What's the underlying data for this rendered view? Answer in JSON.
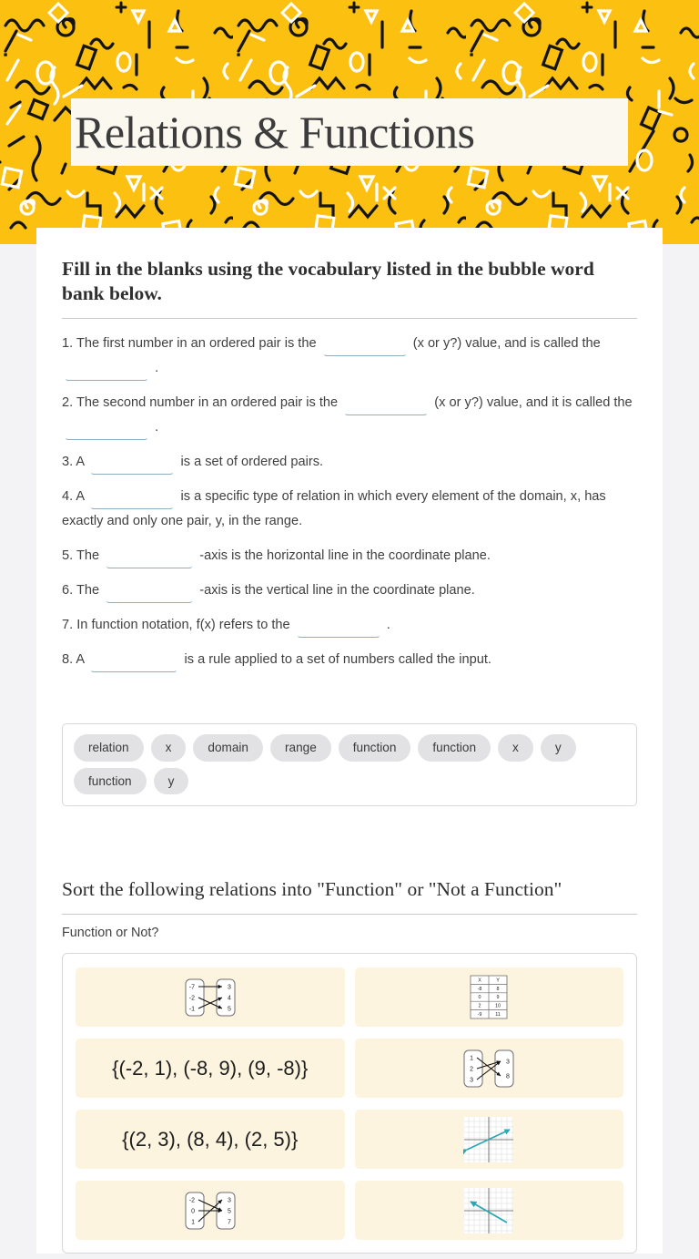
{
  "header": {
    "title": "Relations & Functions",
    "banner_color": "#fbc010",
    "title_band_color": "#fbf8ef"
  },
  "section1": {
    "heading": "Fill in the blanks using the vocabulary listed in the bubble word bank below.",
    "questions": [
      {
        "number": "1.",
        "parts": [
          "The first number in an ordered pair is the",
          "(x or y?) value, and is called the",
          "."
        ],
        "blanks": 2
      },
      {
        "number": "2.",
        "parts": [
          "The second number in an ordered pair is the",
          "(x or y?) value, and it is called the",
          "."
        ],
        "blanks": 2
      },
      {
        "number": "3.",
        "parts": [
          "A",
          "is a set of ordered pairs."
        ],
        "blanks": 1
      },
      {
        "number": "4.",
        "parts": [
          "A",
          "is a specific type of relation in which every element of the domain, x, has exactly and only one pair, y, in the range."
        ],
        "blanks": 1
      },
      {
        "number": "5.",
        "parts": [
          "The",
          "-axis is the horizontal line in the coordinate plane."
        ],
        "blanks": 1
      },
      {
        "number": "6.",
        "parts": [
          "The",
          "-axis is the vertical line in the coordinate plane."
        ],
        "blanks": 1
      },
      {
        "number": "7.",
        "parts": [
          "In function notation, f(x) refers to the",
          "."
        ],
        "blanks": 1
      },
      {
        "number": "8.",
        "parts": [
          "A",
          "is a rule applied to a set of numbers called the input."
        ],
        "blanks": 1
      }
    ],
    "blank_value": "",
    "blank_placeholder": ""
  },
  "word_bank": {
    "bubbles": [
      "relation",
      "x",
      "domain",
      "range",
      "function",
      "function",
      "x",
      "y",
      "function",
      "y"
    ],
    "bubble_color": "#e2e2e4"
  },
  "section2": {
    "heading": "Sort the following relations into \"Function\" or \"Not a Function\"",
    "sublabel": "Function or Not?",
    "card_color": "#fdf4e0",
    "graph_line_color": "#2aa7b0",
    "cards": [
      {
        "kind": "mapping",
        "name": "mapping-diagram-1",
        "left": [
          "-7",
          "-2",
          "-1"
        ],
        "right": [
          "3",
          "4",
          "5"
        ],
        "arrows": [
          [
            0,
            0
          ],
          [
            1,
            2
          ],
          [
            2,
            1
          ]
        ]
      },
      {
        "kind": "table",
        "name": "xy-table-1",
        "headers": [
          "X",
          "Y"
        ],
        "rows": [
          [
            "-8",
            "8"
          ],
          [
            "0",
            "9"
          ],
          [
            "2",
            "10"
          ],
          [
            "-9",
            "11"
          ]
        ]
      },
      {
        "kind": "text",
        "name": "ordered-pairs-1",
        "text": "{(-2, 1), (-8, 9), (9, -8)}"
      },
      {
        "kind": "mapping",
        "name": "mapping-diagram-2",
        "left": [
          "1",
          "2",
          "3"
        ],
        "right": [
          "3",
          "8"
        ],
        "arrows": [
          [
            0,
            1
          ],
          [
            1,
            0
          ],
          [
            2,
            0
          ]
        ]
      },
      {
        "kind": "text",
        "name": "ordered-pairs-2",
        "text": "{(2, 3), (8, 4), (2, 5)}"
      },
      {
        "kind": "graph",
        "name": "line-graph-positive-slope",
        "slope": "positive"
      },
      {
        "kind": "mapping",
        "name": "mapping-diagram-3",
        "left": [
          "-2",
          "0",
          "1"
        ],
        "right": [
          "3",
          "5",
          "7"
        ],
        "arrows": [
          [
            0,
            1
          ],
          [
            1,
            1
          ],
          [
            2,
            0
          ]
        ]
      },
      {
        "kind": "graph",
        "name": "line-graph-negative-slope",
        "slope": "negative"
      }
    ]
  }
}
